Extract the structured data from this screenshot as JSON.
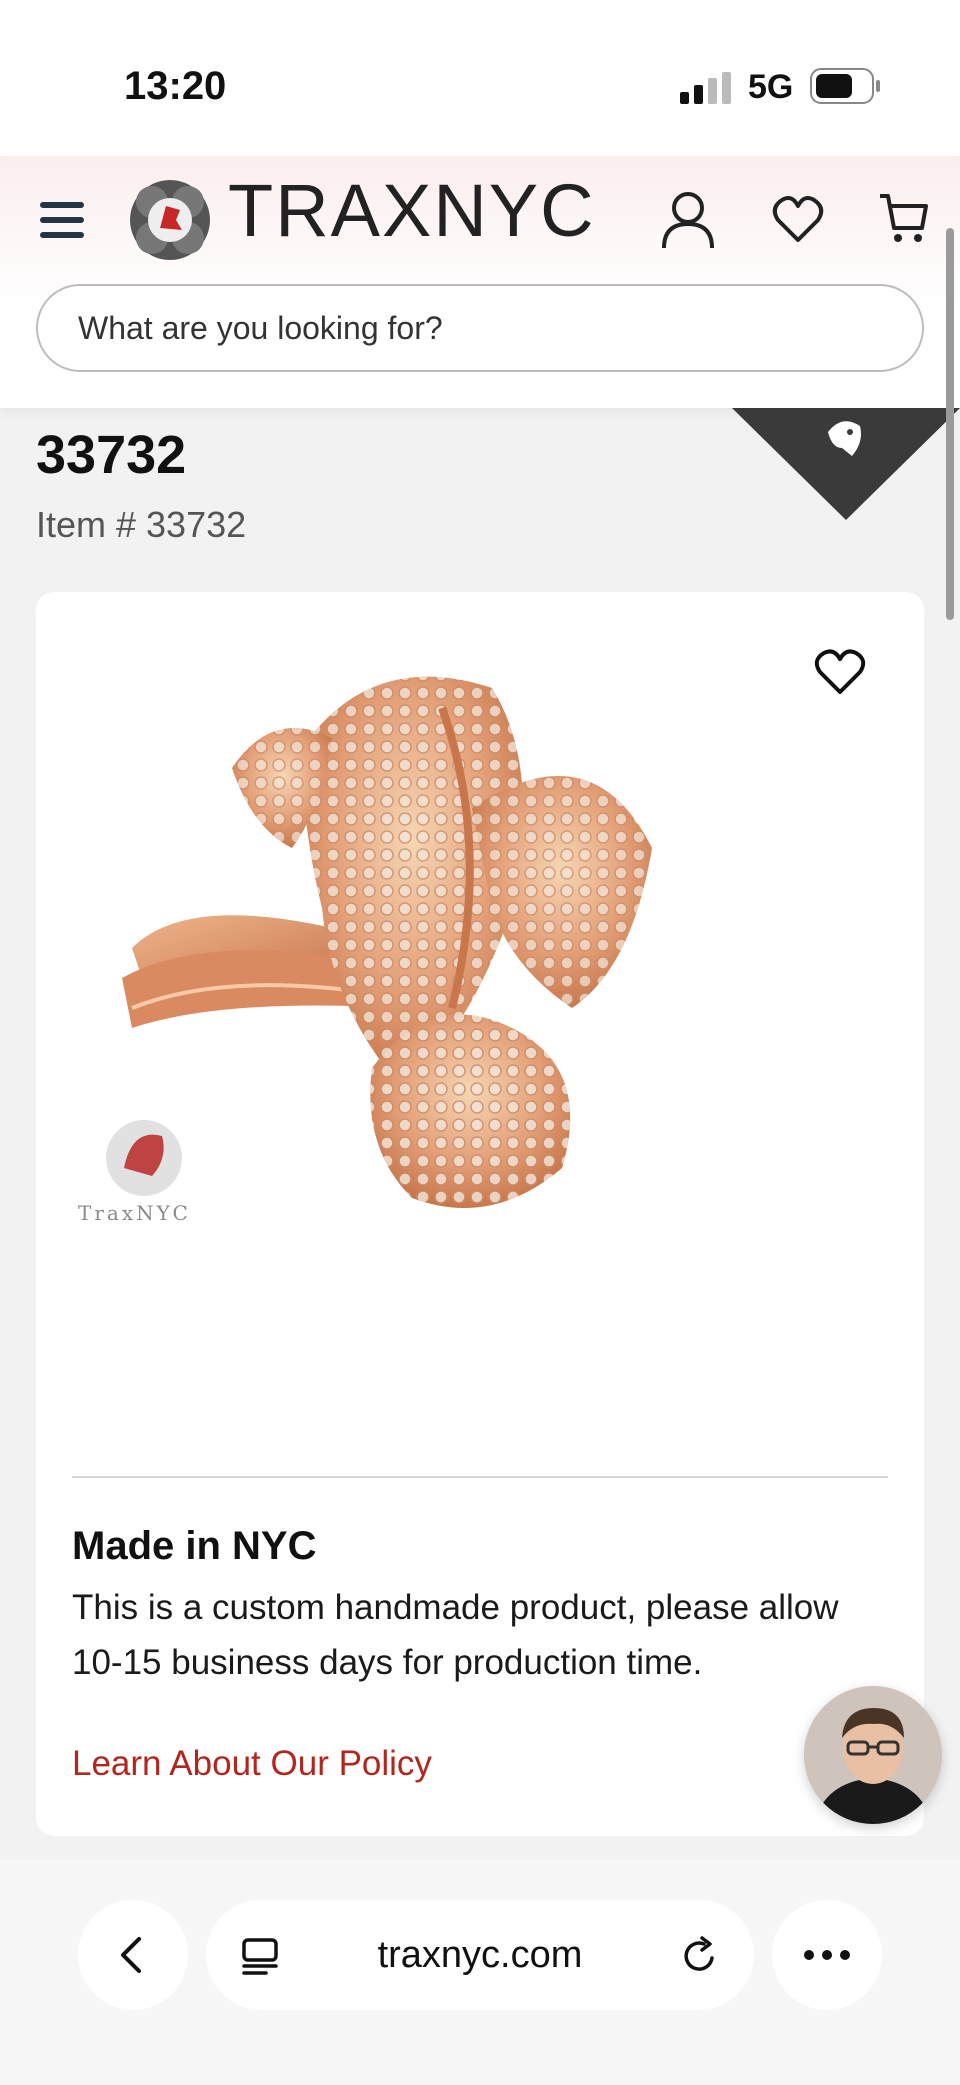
{
  "status_bar": {
    "time": "13:20",
    "network": "5G",
    "signal_icon": "signal-bars-icon",
    "battery_icon": "battery-icon"
  },
  "header": {
    "brand": "TRAXNYC",
    "menu_icon": "hamburger-menu-icon",
    "account_icon": "user-icon",
    "wishlist_icon": "heart-icon",
    "cart_icon": "cart-icon",
    "search_placeholder": "What are you looking for?"
  },
  "product": {
    "title": "33732",
    "item_number": "Item # 33732",
    "favorite_icon": "heart-icon",
    "image_description_icon": "ring-photo",
    "watermark": "TraxNYC",
    "made_title": "Made in NYC",
    "made_text": "This is a custom handmade product, please allow 10-15 business days for production time.",
    "policy_link": "Learn About Our Policy"
  },
  "browser": {
    "url": "traxnyc.com",
    "back_icon": "chevron-left-icon",
    "tabs_icon": "tabs-icon",
    "reload_icon": "reload-icon",
    "more_icon": "more-dots-icon"
  },
  "colors": {
    "accent": "#b3261e",
    "ribbon": "#3a3a3a",
    "background": "#f2f2f2"
  }
}
